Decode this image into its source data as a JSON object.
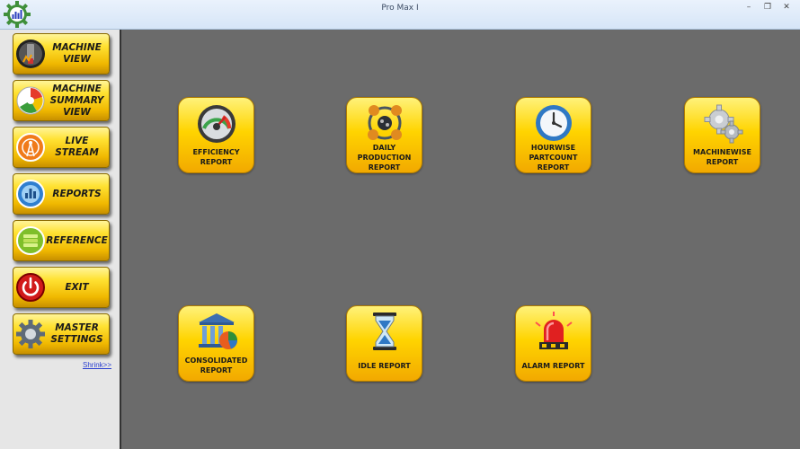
{
  "window": {
    "title": "Pro Max I",
    "minimize": "–",
    "restore": "❐",
    "close": "✕"
  },
  "sidebar": {
    "items": [
      {
        "label": "MACHINE VIEW",
        "icon": "machine-view-icon"
      },
      {
        "label": "MACHINE SUMMARY VIEW",
        "icon": "summary-gauge-icon"
      },
      {
        "label": "LIVE STREAM",
        "icon": "broadcast-tower-icon"
      },
      {
        "label": "REPORTS",
        "icon": "reports-icon"
      },
      {
        "label": "REFERENCE",
        "icon": "reference-icon"
      },
      {
        "label": "EXIT",
        "icon": "power-icon"
      },
      {
        "label": "MASTER SETTINGS",
        "icon": "gear-icon"
      }
    ],
    "shrink_label": "Shrink>>"
  },
  "reports": [
    {
      "label": "EFFICIENCY REPORT",
      "icon": "speedometer-icon"
    },
    {
      "label": "DAILY PRODUCTION REPORT",
      "icon": "production-cycle-icon"
    },
    {
      "label": "HOURWISE PARTCOUNT REPORT",
      "icon": "clock-icon"
    },
    {
      "label": "MACHINEWISE REPORT",
      "icon": "gears-icon"
    },
    {
      "label": "CONSOLIDATED REPORT",
      "icon": "bank-chart-icon"
    },
    {
      "label": "IDLE REPORT",
      "icon": "hourglass-icon"
    },
    {
      "label": "ALARM REPORT",
      "icon": "siren-icon"
    }
  ],
  "colors": {
    "accent": "#ffd400",
    "background": "#6b6b6b",
    "sidebar": "#e6e6e6",
    "link": "#2a3fd0"
  }
}
